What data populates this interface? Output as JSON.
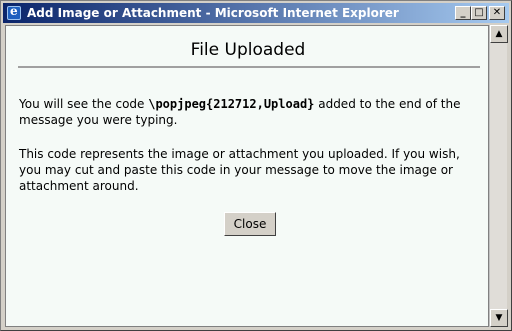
{
  "window": {
    "title": "Add Image or Attachment - Microsoft Internet Explorer",
    "icon": "ie-icon",
    "controls": {
      "minimize": "_",
      "maximize": "□",
      "close": "✕"
    }
  },
  "page": {
    "heading": "File Uploaded",
    "para1_before": "You will see the code ",
    "para1_code": "\\popjpeg{212712,Upload}",
    "para1_after": " added to the end of the message you were typing.",
    "para2": "This code represents the image or attachment you uploaded. If you wish, you may cut and paste this code in your message to move the image or attachment around.",
    "close_label": "Close"
  },
  "scrollbar": {
    "up": "▲",
    "down": "▼"
  }
}
